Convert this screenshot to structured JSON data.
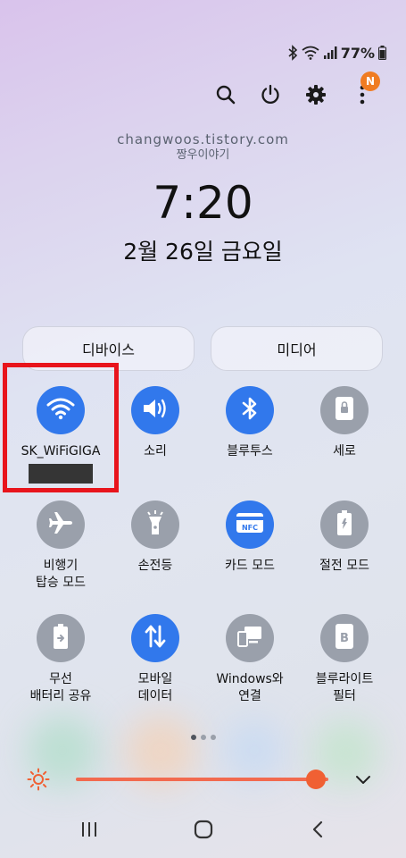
{
  "status_bar": {
    "battery_text": "77%",
    "icons": [
      "bluetooth-icon",
      "wifi-icon",
      "signal-icon",
      "battery-icon"
    ]
  },
  "top_actions": {
    "icons": [
      "search-icon",
      "power-icon",
      "settings-icon",
      "more-icon"
    ],
    "notification_badge": "N"
  },
  "watermark": {
    "line1": "changwoos.tistory.com",
    "line2": "짱우이야기"
  },
  "clock": {
    "time": "7:20",
    "date": "2월 26일 금요일"
  },
  "panels": {
    "device_label": "디바이스",
    "media_label": "미디어"
  },
  "tiles": [
    {
      "label": "SK_WiFiGIGA",
      "icon": "wifi-icon",
      "state": "on"
    },
    {
      "label": "소리",
      "icon": "sound-icon",
      "state": "on"
    },
    {
      "label": "블루투스",
      "icon": "bluetooth-icon",
      "state": "on"
    },
    {
      "label": "세로",
      "icon": "rotation-lock-icon",
      "state": "off"
    },
    {
      "label": "비행기\n탑승 모드",
      "icon": "airplane-icon",
      "state": "off"
    },
    {
      "label": "손전등",
      "icon": "flashlight-icon",
      "state": "off"
    },
    {
      "label": "카드 모드",
      "icon": "nfc-icon",
      "state": "on"
    },
    {
      "label": "절전 모드",
      "icon": "power-saving-icon",
      "state": "off"
    },
    {
      "label": "무선\n배터리 공유",
      "icon": "wireless-powershare-icon",
      "state": "off"
    },
    {
      "label": "모바일\n데이터",
      "icon": "mobile-data-icon",
      "state": "on"
    },
    {
      "label": "Windows와\n연결",
      "icon": "link-to-windows-icon",
      "state": "off"
    },
    {
      "label": "블루라이트\n필터",
      "icon": "blue-light-filter-icon",
      "state": "off"
    }
  ],
  "nfc_text": "NFC",
  "blue_light_text": "B",
  "brightness": {
    "level": 0.95,
    "icon": "sun-icon"
  },
  "pager": {
    "pages": 3,
    "active": 0
  },
  "colors": {
    "accent_on": "#3178ec",
    "tile_off": "#9aa0ab",
    "brightness": "#f06033",
    "highlight": "#e8141c"
  }
}
